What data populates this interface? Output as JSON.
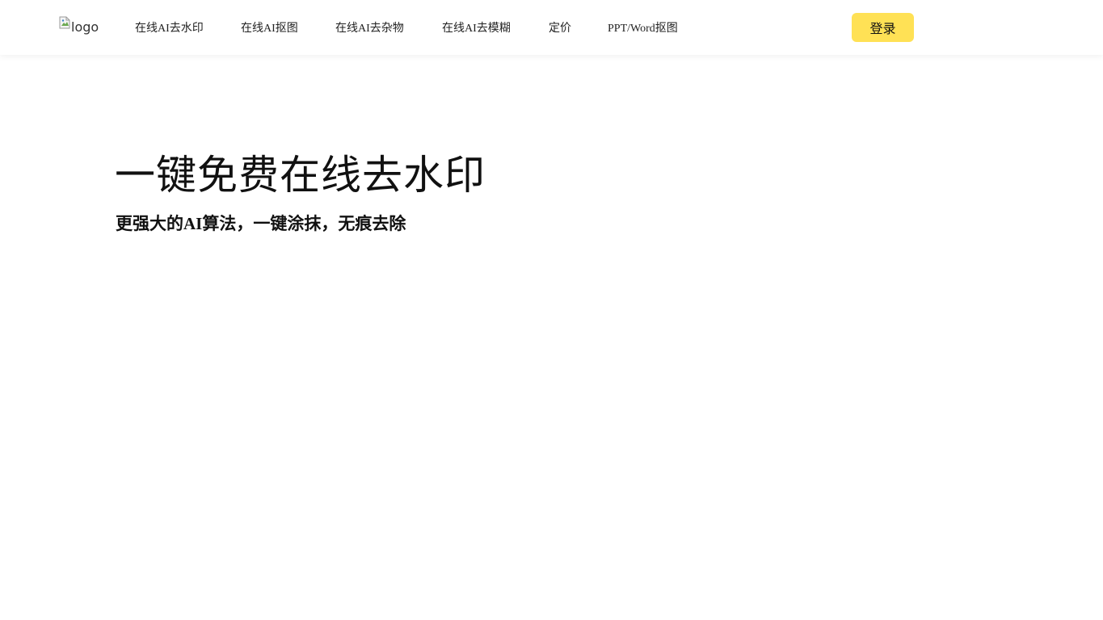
{
  "header": {
    "logo_alt": "logo",
    "nav": [
      {
        "label": "在线AI去水印"
      },
      {
        "label": "在线AI抠图"
      },
      {
        "label": "在线AI去杂物"
      },
      {
        "label": "在线AI去模糊"
      },
      {
        "label": "定价"
      },
      {
        "label": "PPT/Word抠图"
      }
    ],
    "login_label": "登录"
  },
  "hero": {
    "title": "一键免费在线去水印",
    "subtitle": "更强大的AI算法，一键涂抹，无痕去除"
  },
  "colors": {
    "login_button_bg": "#ffe155",
    "text": "#111111",
    "background": "#ffffff"
  },
  "icons": {
    "logo": "broken-image-icon"
  }
}
